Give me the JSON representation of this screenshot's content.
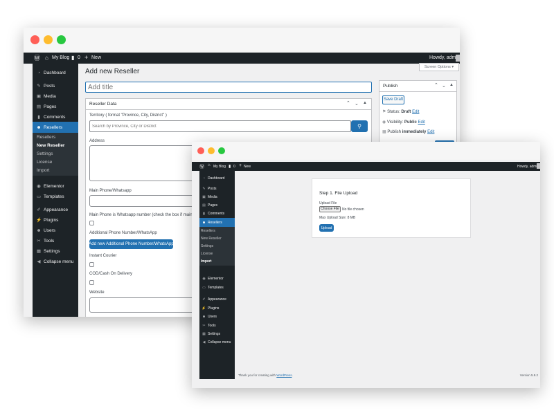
{
  "colors": {
    "admin_bar": "#1d2327",
    "sidebar": "#1d2327",
    "submenu": "#2c3338",
    "accent": "#2271b1",
    "content_bg": "#f0f0f1",
    "close_dot": "#ff5f57",
    "minimize_dot": "#febc2e",
    "zoom_dot": "#28c840"
  },
  "admin_bar": {
    "logo_icon": "wordpress-icon",
    "site_name": "My Blog",
    "comments_count": "0",
    "new_label": "New",
    "greeting": "Howdy, admin"
  },
  "sidebar": {
    "items": [
      {
        "icon": "dashboard-icon",
        "label": "Dashboard"
      },
      {
        "icon": "pin-icon",
        "label": "Posts"
      },
      {
        "icon": "media-icon",
        "label": "Media"
      },
      {
        "icon": "pages-icon",
        "label": "Pages"
      },
      {
        "icon": "comments-icon",
        "label": "Comments"
      },
      {
        "icon": "users-icon",
        "label": "Resellers"
      },
      {
        "icon": "elementor-icon",
        "label": "Elementor"
      },
      {
        "icon": "templates-icon",
        "label": "Templates"
      },
      {
        "icon": "appearance-icon",
        "label": "Appearance"
      },
      {
        "icon": "plugins-icon",
        "label": "Plugins"
      },
      {
        "icon": "users-icon",
        "label": "Users"
      },
      {
        "icon": "tools-icon",
        "label": "Tools"
      },
      {
        "icon": "settings-icon",
        "label": "Settings"
      },
      {
        "icon": "collapse-icon",
        "label": "Collapse menu"
      }
    ],
    "submenu": [
      "Resellers",
      "New Reseller",
      "Settings",
      "License",
      "Import"
    ]
  },
  "editor": {
    "screen_options": "Screen Options ▾",
    "page_title": "Add new Reseller",
    "title_placeholder": "Add title",
    "reseller_box_title": "Reseller Data",
    "territory_label": "Territory ( format \"Province, City, District\" )",
    "territory_placeholder": "Search by Province, City or District",
    "address_label": "Address",
    "main_phone_label": "Main Phone/Whatsapp",
    "main_phone_whatsapp_note": "Main Phone is Whatsapp number (check the box if main phon",
    "additional_phone_label": "Additional Phone Number/WhatsApp",
    "add_phone_button": "Add new Additional Phone Number/WhatsApp",
    "instant_courier_label": "Instant Courier",
    "cod_label": "COD/Cash On Delivery",
    "website_label": "Website",
    "publish": {
      "title": "Publish",
      "save_draft": "Save Draft",
      "status_label": "Status:",
      "status_value": "Draft",
      "visibility_label": "Visibility:",
      "visibility_value": "Public",
      "publish_label": "Publish",
      "publish_value": "immediately",
      "edit": "Edit"
    }
  },
  "import_page": {
    "card_title": "Step 1. File Upload",
    "upload_label": "Upload File",
    "choose_file": "Choose File",
    "no_file": "No file chosen",
    "max_size": "Max Upload Size: 8 MB",
    "upload_button": "Upload",
    "footer_text": "Thank you for creating with",
    "footer_link": "WordPress",
    "footer_end": ".",
    "version": "Version 5.9.2"
  }
}
